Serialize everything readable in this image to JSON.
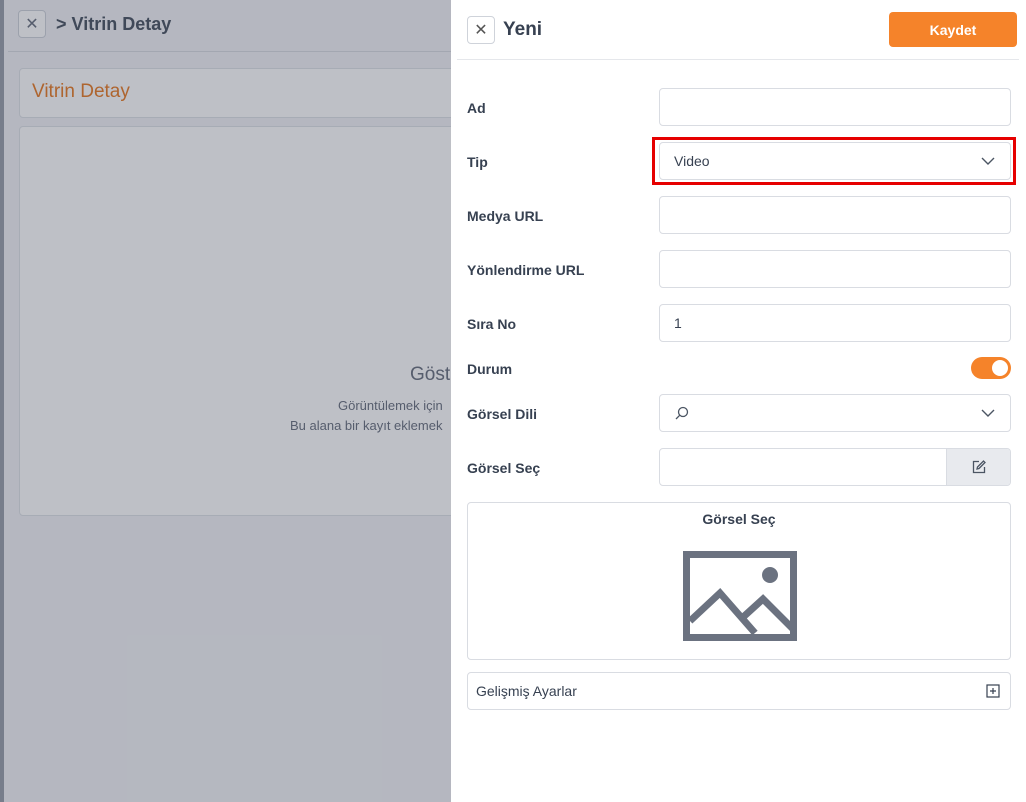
{
  "background": {
    "title": "> Vitrin Detay",
    "card_title": "Vitrin Detay",
    "empty_title": "Göst",
    "empty_line1": "Görüntülemek için",
    "empty_line2": "Bu alana bir kayıt eklemek"
  },
  "drawer": {
    "title": "Yeni",
    "save_label": "Kaydet",
    "fields": {
      "ad": {
        "label": "Ad",
        "value": ""
      },
      "tip": {
        "label": "Tip",
        "value": "Video"
      },
      "medya_url": {
        "label": "Medya URL",
        "value": ""
      },
      "yonlendirme_url": {
        "label": "Yönlendirme URL",
        "value": ""
      },
      "sira_no": {
        "label": "Sıra No",
        "value": "1"
      },
      "durum": {
        "label": "Durum",
        "on": true
      },
      "gorsel_dili": {
        "label": "Görsel Dili",
        "value": ""
      },
      "gorsel_sec": {
        "label": "Görsel Seç",
        "value": ""
      }
    },
    "image_box_caption": "Görsel Seç",
    "advanced_label": "Gelişmiş Ayarlar"
  },
  "colors": {
    "accent": "#f5832a",
    "highlight": "#e60000",
    "bg_title_orange": "#e97d28"
  }
}
